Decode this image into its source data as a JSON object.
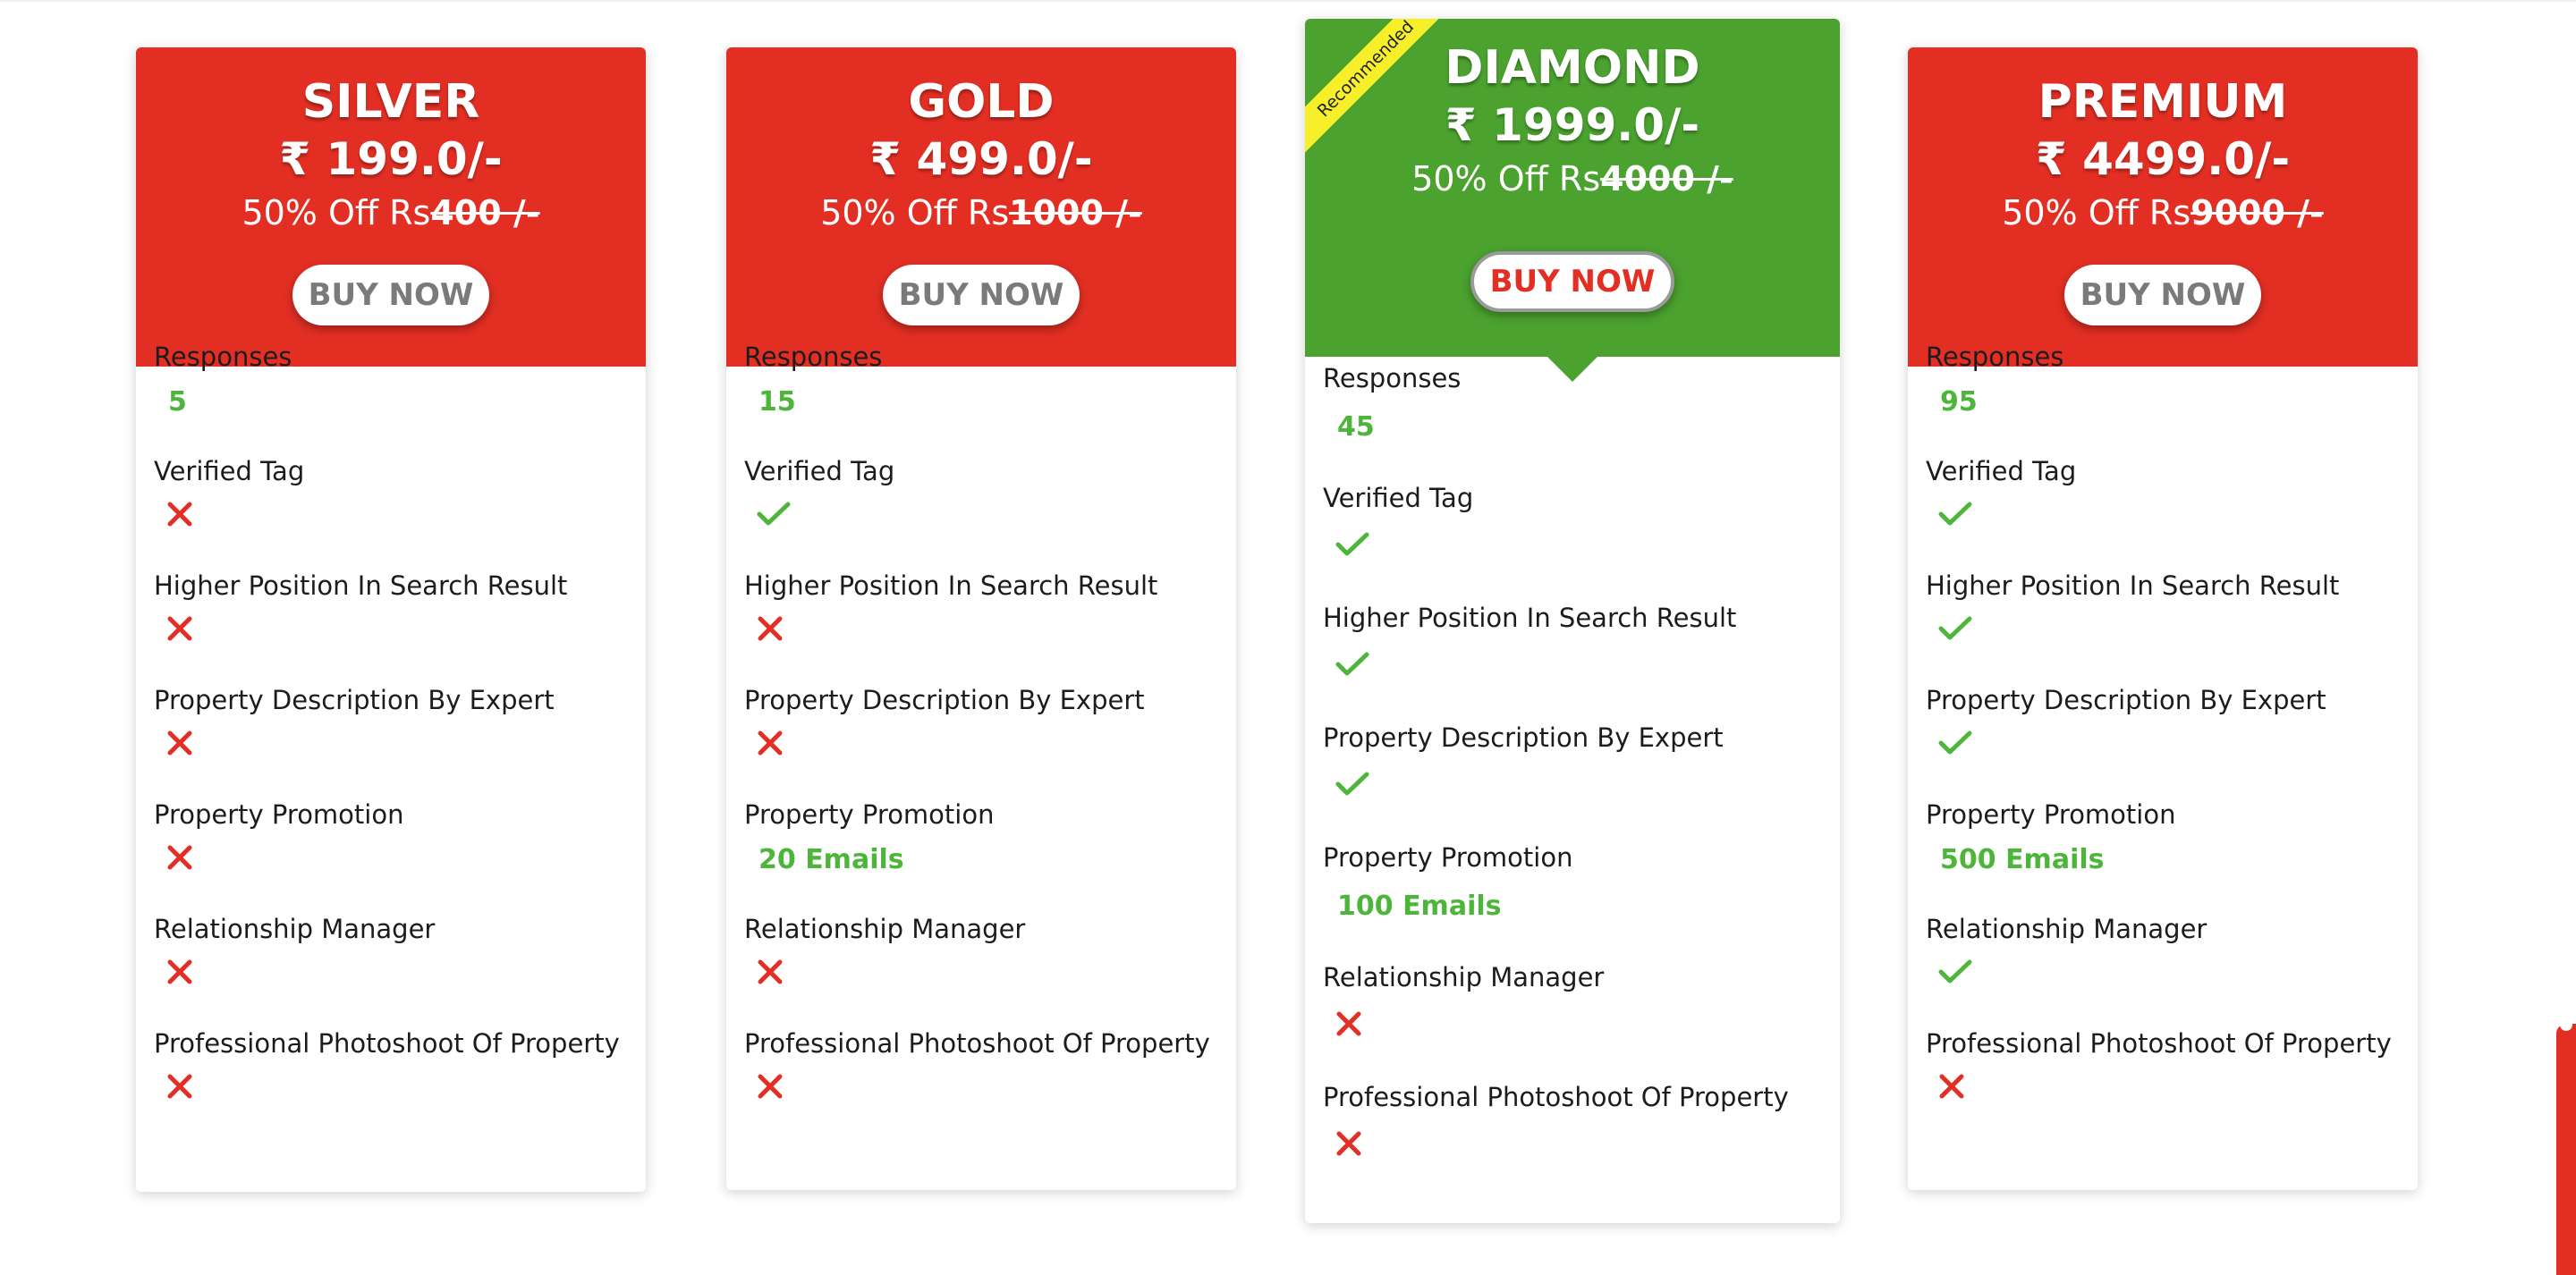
{
  "colors": {
    "header_red": "#e32f23",
    "header_green": "#4ba22f",
    "value_green": "#4db63a",
    "cross_red": "#e32f23",
    "ribbon_yellow": "#f6ef2a"
  },
  "plans": [
    {
      "name": "SILVER",
      "price": "₹ 199.0/-",
      "offer_prefix": "50% Off Rs",
      "offer_original": "400 /-",
      "buy_label": "BUY NOW",
      "recommended": false,
      "features": [
        {
          "label": "Responses",
          "type": "text",
          "value": "5"
        },
        {
          "label": "Verified Tag",
          "type": "icon",
          "value": "cross-icon"
        },
        {
          "label": "Higher Position In Search Result",
          "type": "icon",
          "value": "cross-icon"
        },
        {
          "label": "Property Description By Expert",
          "type": "icon",
          "value": "cross-icon"
        },
        {
          "label": "Property Promotion",
          "type": "icon",
          "value": "cross-icon"
        },
        {
          "label": "Relationship Manager",
          "type": "icon",
          "value": "cross-icon"
        },
        {
          "label": "Professional Photoshoot Of Property",
          "type": "icon",
          "value": "cross-icon"
        }
      ]
    },
    {
      "name": "GOLD",
      "price": "₹ 499.0/-",
      "offer_prefix": "50% Off Rs",
      "offer_original": "1000 /-",
      "buy_label": "BUY NOW",
      "recommended": false,
      "features": [
        {
          "label": "Responses",
          "type": "text",
          "value": "15"
        },
        {
          "label": "Verified Tag",
          "type": "icon",
          "value": "check-icon"
        },
        {
          "label": "Higher Position In Search Result",
          "type": "icon",
          "value": "cross-icon"
        },
        {
          "label": "Property Description By Expert",
          "type": "icon",
          "value": "cross-icon"
        },
        {
          "label": "Property Promotion",
          "type": "text",
          "value": "20 Emails"
        },
        {
          "label": "Relationship Manager",
          "type": "icon",
          "value": "cross-icon"
        },
        {
          "label": "Professional Photoshoot Of Property",
          "type": "icon",
          "value": "cross-icon"
        }
      ]
    },
    {
      "name": "DIAMOND",
      "price": "₹ 1999.0/-",
      "offer_prefix": "50% Off Rs",
      "offer_original": "4000 /-",
      "buy_label": "BUY NOW",
      "recommended": true,
      "ribbon_text": "Recommended",
      "features": [
        {
          "label": "Responses",
          "type": "text",
          "value": "45"
        },
        {
          "label": "Verified Tag",
          "type": "icon",
          "value": "check-icon"
        },
        {
          "label": "Higher Position In Search Result",
          "type": "icon",
          "value": "check-icon"
        },
        {
          "label": "Property Description By Expert",
          "type": "icon",
          "value": "check-icon"
        },
        {
          "label": "Property Promotion",
          "type": "text",
          "value": "100 Emails"
        },
        {
          "label": "Relationship Manager",
          "type": "icon",
          "value": "cross-icon"
        },
        {
          "label": "Professional Photoshoot Of Property",
          "type": "icon",
          "value": "cross-icon"
        }
      ]
    },
    {
      "name": "PREMIUM",
      "price": "₹ 4499.0/-",
      "offer_prefix": "50% Off Rs",
      "offer_original": "9000 /-",
      "buy_label": "BUY NOW",
      "recommended": false,
      "features": [
        {
          "label": "Responses",
          "type": "text",
          "value": "95"
        },
        {
          "label": "Verified Tag",
          "type": "icon",
          "value": "check-icon"
        },
        {
          "label": "Higher Position In Search Result",
          "type": "icon",
          "value": "check-icon"
        },
        {
          "label": "Property Description By Expert",
          "type": "icon",
          "value": "check-icon"
        },
        {
          "label": "Property Promotion",
          "type": "text",
          "value": "500 Emails"
        },
        {
          "label": "Relationship Manager",
          "type": "icon",
          "value": "check-icon"
        },
        {
          "label": "Professional Photoshoot Of Property",
          "type": "icon",
          "value": "cross-icon"
        }
      ]
    }
  ]
}
